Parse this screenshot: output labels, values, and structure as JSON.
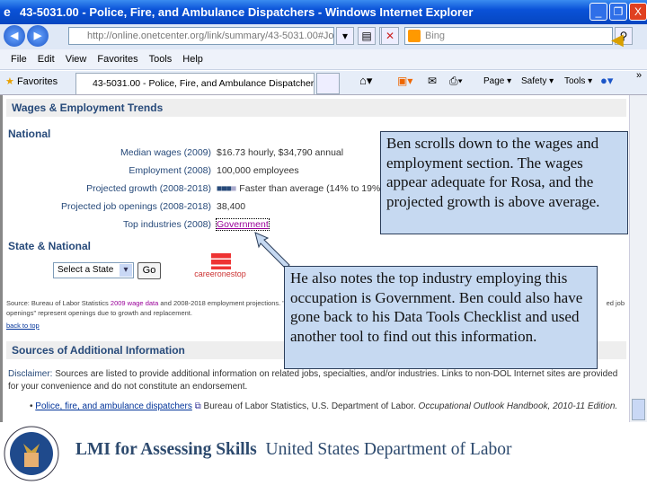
{
  "window": {
    "title": "43-5031.00 - Police, Fire, and Ambulance Dispatchers - Windows Internet Explorer",
    "minimize": "_",
    "restore": "❐",
    "close": "X"
  },
  "address": {
    "url": "http://online.onetcenter.org/link/summary/43-5031.00#Job",
    "search_placeholder": "Bing"
  },
  "menu": [
    "File",
    "Edit",
    "View",
    "Favorites",
    "Tools",
    "Help"
  ],
  "favorites": {
    "label": "Favorites",
    "tab": "43-5031.00 - Police, Fire, and Ambulance Dispatchers",
    "commands": [
      "Page ▾",
      "Safety ▾",
      "Tools ▾"
    ]
  },
  "page": {
    "section_title": "Wages & Employment Trends",
    "national": "National",
    "rows": [
      {
        "label": "Median wages (2009)",
        "value": "$16.73 hourly, $34,790 annual"
      },
      {
        "label": "Employment (2008)",
        "value": "100,000 employees"
      },
      {
        "label": "Projected growth (2008-2018)",
        "value": "Faster than average (14% to 19%)"
      },
      {
        "label": "Projected job openings (2008-2018)",
        "value": "38,400"
      },
      {
        "label": "Top industries (2008)",
        "value": "Government"
      }
    ],
    "growth_level": "3 of 4 bars",
    "state_national": "State & National",
    "state_select": "Select a State",
    "go": "Go",
    "careeronestop": "careeronestop",
    "source_a": "Source: Bureau of Labor Statistics ",
    "source_link1": "2009 wage data",
    "source_b": " and 2008-2018 employment projections",
    "source_c": ". \"Proj",
    "source_d": "ed job",
    "source_line2": "openings\" represent openings due to growth and replacement.",
    "back_to_top": "back to top",
    "sources_title": "Sources of Additional Information",
    "disclaimer_label": "Disclaimer:",
    "disclaimer": " Sources are listed to provide additional information on related jobs, specialties, and/or industries. Links to non-DOL Internet sites are provided for your convenience and do not constitute an endorsement.",
    "source_item_link": "Police, fire, and ambulance dispatchers",
    "source_item_text": " Bureau of Labor Statistics, U.S. Department of Labor. ",
    "source_item_italic": "Occupational Outlook Handbook, 2010-11 Edition."
  },
  "callouts": {
    "one": "Ben scrolls down to the wages and employment section.  The wages appear adequate for Rosa, and the projected growth is above average.",
    "two": "He also notes the top industry employing this occupation is Government.  Ben could also have gone back to his Data Tools Checklist and used another tool to find out this information."
  },
  "footer": {
    "title": "LMI for Assessing Skills",
    "org": "United States Department of Labor"
  },
  "colors": {
    "callout_bg": "#c6d9f1",
    "heading": "#274a7a",
    "titlebar": "#0a52d8"
  }
}
